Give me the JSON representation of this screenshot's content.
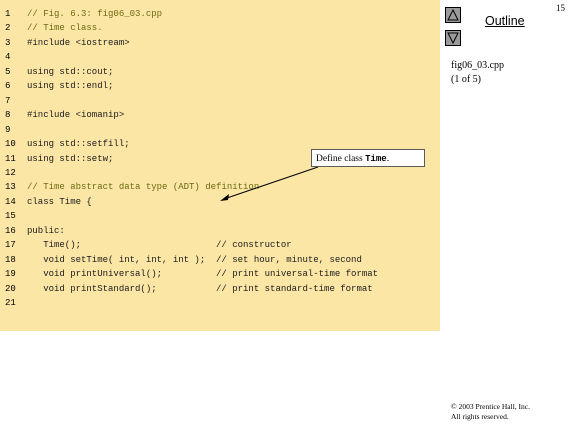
{
  "slide": {
    "page_number": "15",
    "outline_title": "Outline",
    "file_name": "fig06_03.cpp",
    "file_part": "(1 of 5)",
    "copyright_line1": "© 2003 Prentice Hall, Inc.",
    "copyright_line2": "All rights reserved.",
    "nav_up_icon": "triangle-up-icon",
    "nav_down_icon": "triangle-down-icon"
  },
  "callout": {
    "text": "Define class ",
    "code": "Time",
    "suffix": "."
  },
  "code": {
    "lines": [
      {
        "n": "1",
        "text": "// Fig. 6.3: fig06_03.cpp"
      },
      {
        "n": "2",
        "text": "// Time class."
      },
      {
        "n": "3",
        "text": "#include <iostream>"
      },
      {
        "n": "4",
        "text": ""
      },
      {
        "n": "5",
        "text": "using std::cout;"
      },
      {
        "n": "6",
        "text": "using std::endl;"
      },
      {
        "n": "7",
        "text": ""
      },
      {
        "n": "8",
        "text": "#include <iomanip>"
      },
      {
        "n": "9",
        "text": ""
      },
      {
        "n": "10",
        "text": "using std::setfill;"
      },
      {
        "n": "11",
        "text": "using std::setw;"
      },
      {
        "n": "12",
        "text": ""
      },
      {
        "n": "13",
        "text": "// Time abstract data type (ADT) definition"
      },
      {
        "n": "14",
        "text": "class Time {"
      },
      {
        "n": "15",
        "text": ""
      },
      {
        "n": "16",
        "text": "public:"
      },
      {
        "n": "17",
        "text": "   Time();                         // constructor"
      },
      {
        "n": "18",
        "text": "   void setTime( int, int, int );  // set hour, minute, second"
      },
      {
        "n": "19",
        "text": "   void printUniversal();          // print universal-time format"
      },
      {
        "n": "20",
        "text": "   void printStandard();           // print standard-time format"
      },
      {
        "n": "21",
        "text": ""
      }
    ]
  }
}
